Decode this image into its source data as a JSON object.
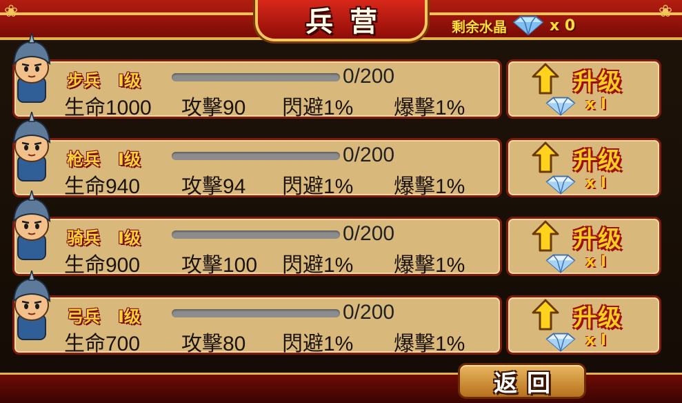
{
  "header": {
    "title": "兵营",
    "crystal_label": "剩余水晶",
    "crystal_count": "x 0",
    "crystal_icon": "diamond-icon"
  },
  "units": [
    {
      "name": "步兵",
      "level": "I级",
      "xp": "0/200",
      "xp_fraction": 0,
      "hp": "生命1000",
      "atk": "攻擊90",
      "dodge": "閃避1%",
      "crit": "爆擊1%",
      "upgrade_label": "升级",
      "cost": "x I",
      "avatar": "infantry-avatar-icon"
    },
    {
      "name": "枪兵",
      "level": "I级",
      "xp": "0/200",
      "xp_fraction": 0,
      "hp": "生命940",
      "atk": "攻擊94",
      "dodge": "閃避1%",
      "crit": "爆擊1%",
      "upgrade_label": "升级",
      "cost": "x I",
      "avatar": "spearman-avatar-icon"
    },
    {
      "name": "骑兵",
      "level": "I级",
      "xp": "0/200",
      "xp_fraction": 0,
      "hp": "生命900",
      "atk": "攻擊100",
      "dodge": "閃避1%",
      "crit": "爆擊1%",
      "upgrade_label": "升级",
      "cost": "x I",
      "avatar": "cavalry-avatar-icon"
    },
    {
      "name": "弓兵",
      "level": "I级",
      "xp": "0/200",
      "xp_fraction": 0,
      "hp": "生命700",
      "atk": "攻擊80",
      "dodge": "閃避1%",
      "crit": "爆擊1%",
      "upgrade_label": "升级",
      "cost": "x I",
      "avatar": "archer-avatar-icon"
    }
  ],
  "footer": {
    "back_label": "返回"
  },
  "colors": {
    "frame_red": "#b31d11",
    "gold": "#f3c75f",
    "card_tan": "#d8b97b",
    "text_yellow": "#ffd23a"
  }
}
